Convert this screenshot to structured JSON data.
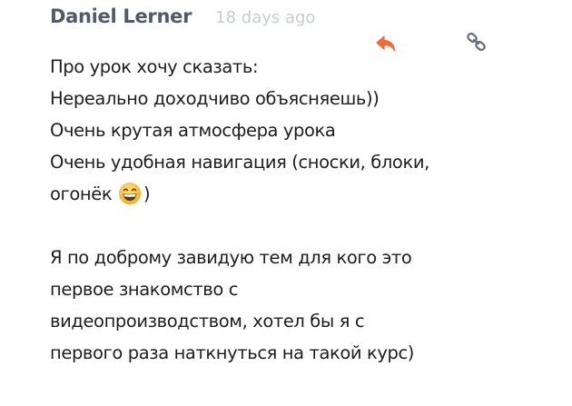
{
  "comment": {
    "author": "Daniel Lerner",
    "timestamp": "18 days ago",
    "actions": {
      "reply_icon": "reply-arrow-icon",
      "link_icon": "chain-link-icon"
    },
    "lines": [
      "Про урок хочу сказать:",
      "Нереально доходчиво объясняешь))",
      "Очень крутая атмосфера урока",
      "Очень удобная навигация (сноски, блоки,"
    ],
    "emoji_line_before": "огонёк",
    "emoji_line_after": ")",
    "emoji_icon": "grinning-face-emoji",
    "paragraph2": [
      "Я по доброму завидую тем для кого это",
      "первое знакомство с",
      "видеопроизводством, хотел бы я с",
      "первого раза наткнуться на такой курс)"
    ],
    "colors": {
      "author": "#4d5c6c",
      "timestamp": "#c7ccd1",
      "reply_accent": "#f26b3a",
      "link_icon": "#5f6b77",
      "text": "#1e1e1e"
    }
  }
}
